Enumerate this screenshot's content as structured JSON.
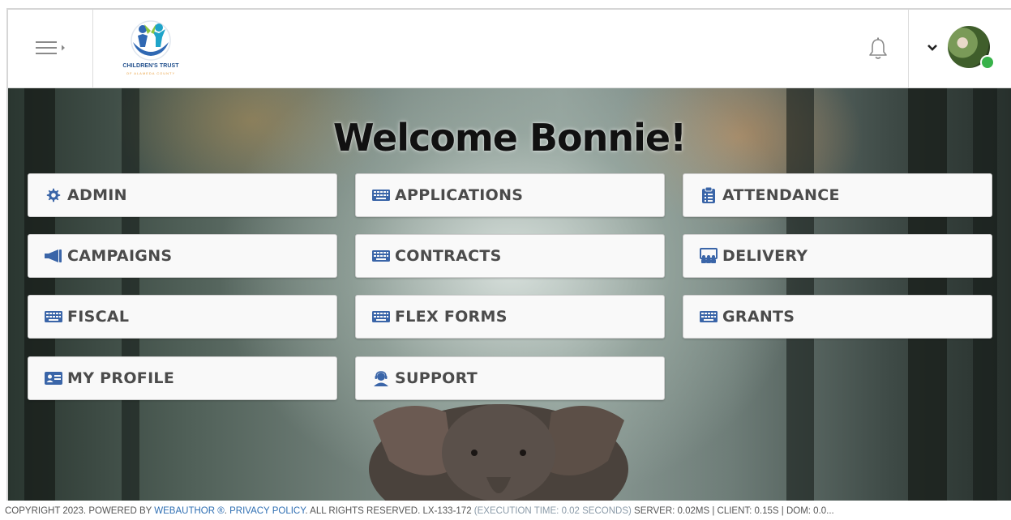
{
  "header": {
    "logo_title": "CHILDREN'S TRUST",
    "logo_subtitle": "OF ALAMEDA COUNTY"
  },
  "hero": {
    "welcome": "Welcome Bonnie!"
  },
  "tiles": [
    {
      "label": "ADMIN",
      "icon": "gear-icon"
    },
    {
      "label": "APPLICATIONS",
      "icon": "keyboard-icon"
    },
    {
      "label": "ATTENDANCE",
      "icon": "clipboard-icon"
    },
    {
      "label": "CAMPAIGNS",
      "icon": "megaphone-icon"
    },
    {
      "label": "CONTRACTS",
      "icon": "keyboard-icon"
    },
    {
      "label": "DELIVERY",
      "icon": "chalkboard-teacher-icon"
    },
    {
      "label": "FISCAL",
      "icon": "keyboard-icon"
    },
    {
      "label": "FLEX FORMS",
      "icon": "keyboard-icon"
    },
    {
      "label": "GRANTS",
      "icon": "keyboard-icon"
    },
    {
      "label": "MY PROFILE",
      "icon": "id-card-icon"
    },
    {
      "label": "SUPPORT",
      "icon": "user-headset-icon"
    }
  ],
  "footer": {
    "copyright": "COPYRIGHT 2023. POWERED BY ",
    "webauthor": "WEBAUTHOR ®",
    "sep": ". ",
    "privacy": "PRIVACY POLICY",
    "rights": ". ALL RIGHTS RESERVED. LX-133-172 ",
    "exec": "(EXECUTION TIME: 0.02 SECONDS)",
    "stats": " SERVER: 0.02MS | CLIENT: 0.15S | DOM: 0.0..."
  },
  "colors": {
    "icon_blue": "#3a65a8",
    "tile_text": "#4b4b4b",
    "link": "#2f6fb3"
  }
}
